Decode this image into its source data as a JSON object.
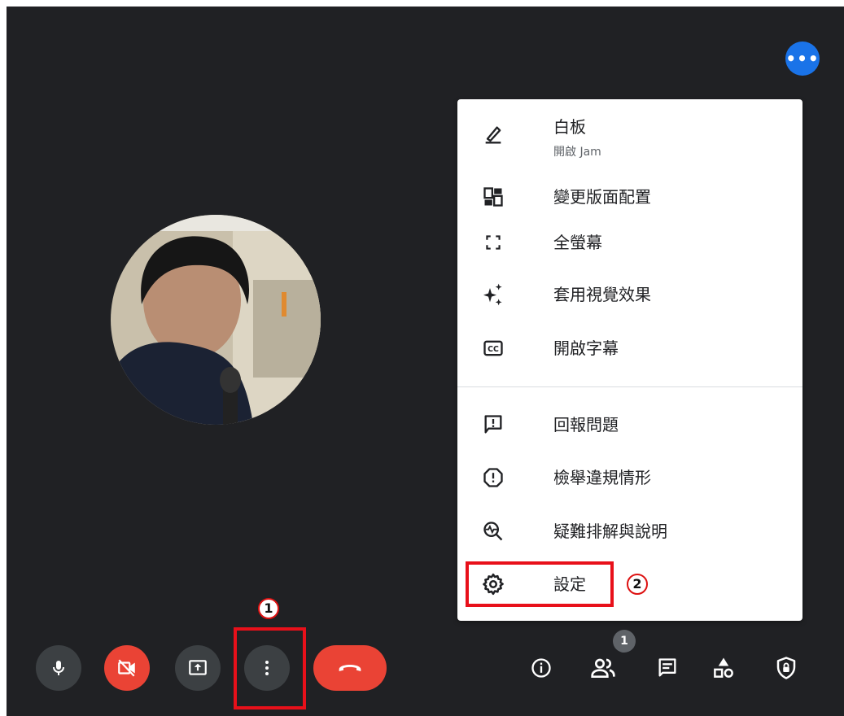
{
  "top": {
    "more_icon": "more-horiz-icon",
    "more_glyph": "•••",
    "accent": "#1a73e8"
  },
  "participant": {
    "avatar_icon": "participant-photo"
  },
  "menu": {
    "items": [
      {
        "icon": "pencil-icon",
        "label": "白板",
        "sublabel": "開啟 Jam"
      },
      {
        "icon": "layout-icon",
        "label": "變更版面配置"
      },
      {
        "icon": "fullscreen-icon",
        "label": "全螢幕"
      },
      {
        "icon": "sparkle-icon",
        "label": "套用視覺效果"
      },
      {
        "icon": "closed-caption-icon",
        "label": "開啟字幕"
      },
      {
        "icon": "feedback-icon",
        "label": "回報問題"
      },
      {
        "icon": "report-icon",
        "label": "檢舉違規情形"
      },
      {
        "icon": "troubleshoot-icon",
        "label": "疑難排解與說明"
      },
      {
        "icon": "gear-icon",
        "label": "設定"
      }
    ]
  },
  "annotations": {
    "step1": "1",
    "step2": "2",
    "highlight_color": "#e8101a"
  },
  "controls": {
    "left": [
      "mic-icon",
      "camera-off-icon",
      "present-icon",
      "more-vert-icon",
      "hang-up-icon"
    ],
    "right": [
      "info-icon",
      "people-icon",
      "chat-icon",
      "activities-icon",
      "host-controls-icon"
    ],
    "people_count": "1",
    "danger_color": "#ea4335"
  }
}
